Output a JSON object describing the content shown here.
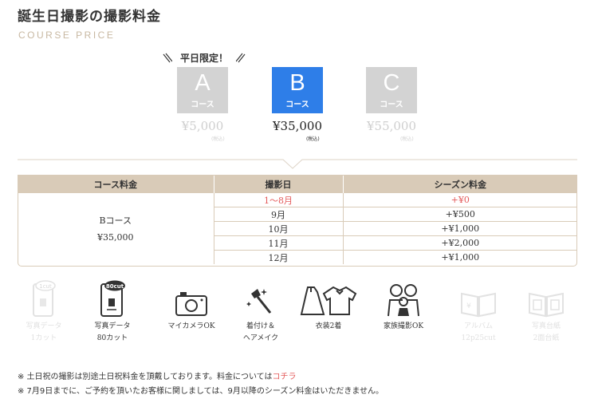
{
  "header": {
    "title": "誕生日撮影の撮影料金",
    "subtitle": "COURSE PRICE"
  },
  "promo": {
    "label": "平日限定！"
  },
  "courses": [
    {
      "letter": "A",
      "label": "コース",
      "price": "¥5,000",
      "tax": "(税込)",
      "state": "inactive"
    },
    {
      "letter": "B",
      "label": "コース",
      "price": "¥35,000",
      "tax": "(税込)",
      "state": "active"
    },
    {
      "letter": "C",
      "label": "コース",
      "price": "¥55,000",
      "tax": "(税込)",
      "state": "inactive"
    }
  ],
  "colors": {
    "active": "#2e7ee8",
    "inactive": "#d3d3d3",
    "table_header": "#d9cbb8",
    "highlight": "#e45a5a"
  },
  "table": {
    "headers": [
      "コース料金",
      "撮影日",
      "シーズン料金"
    ],
    "course_name": "Bコース",
    "course_price": "¥35,000",
    "rows": [
      {
        "date": "1～8月",
        "fee": "+¥0"
      },
      {
        "date": "9月",
        "fee": "+¥500"
      },
      {
        "date": "10月",
        "fee": "+¥1,000"
      },
      {
        "date": "11月",
        "fee": "+¥2,000"
      },
      {
        "date": "12月",
        "fee": "+¥1,000"
      }
    ]
  },
  "features": [
    {
      "icon": "phone-photo-icon",
      "badge": "1cut",
      "line1": "写真データ",
      "line2": "1カット",
      "state": "inactive"
    },
    {
      "icon": "phone-photo-icon",
      "badge": "80cut",
      "line1": "写真データ",
      "line2": "80カット",
      "state": "active"
    },
    {
      "icon": "camera-icon",
      "line1": "マイカメラOK",
      "line2": "",
      "state": "active"
    },
    {
      "icon": "makeup-brush-icon",
      "line1": "着付け＆",
      "line2": "ヘアメイク",
      "state": "active"
    },
    {
      "icon": "costume-icon",
      "line1": "衣装2着",
      "line2": "",
      "state": "active"
    },
    {
      "icon": "family-icon",
      "line1": "家族撮影OK",
      "line2": "",
      "state": "active"
    },
    {
      "icon": "album-icon",
      "line1": "アルバム",
      "line2": "12p25cut",
      "state": "inactive"
    },
    {
      "icon": "photo-frame-icon",
      "line1": "写真台紙",
      "line2": "2面台紙",
      "state": "inactive"
    }
  ],
  "notes": {
    "note1_prefix": "※ 土日祝の撮影は別途土日祝料金を頂戴しております。料金については",
    "note1_link": "コチラ",
    "note2": "※ 7月9日までに、ご予約を頂いたお客様に関しましては、9月以降のシーズン料金はいただきません。"
  }
}
